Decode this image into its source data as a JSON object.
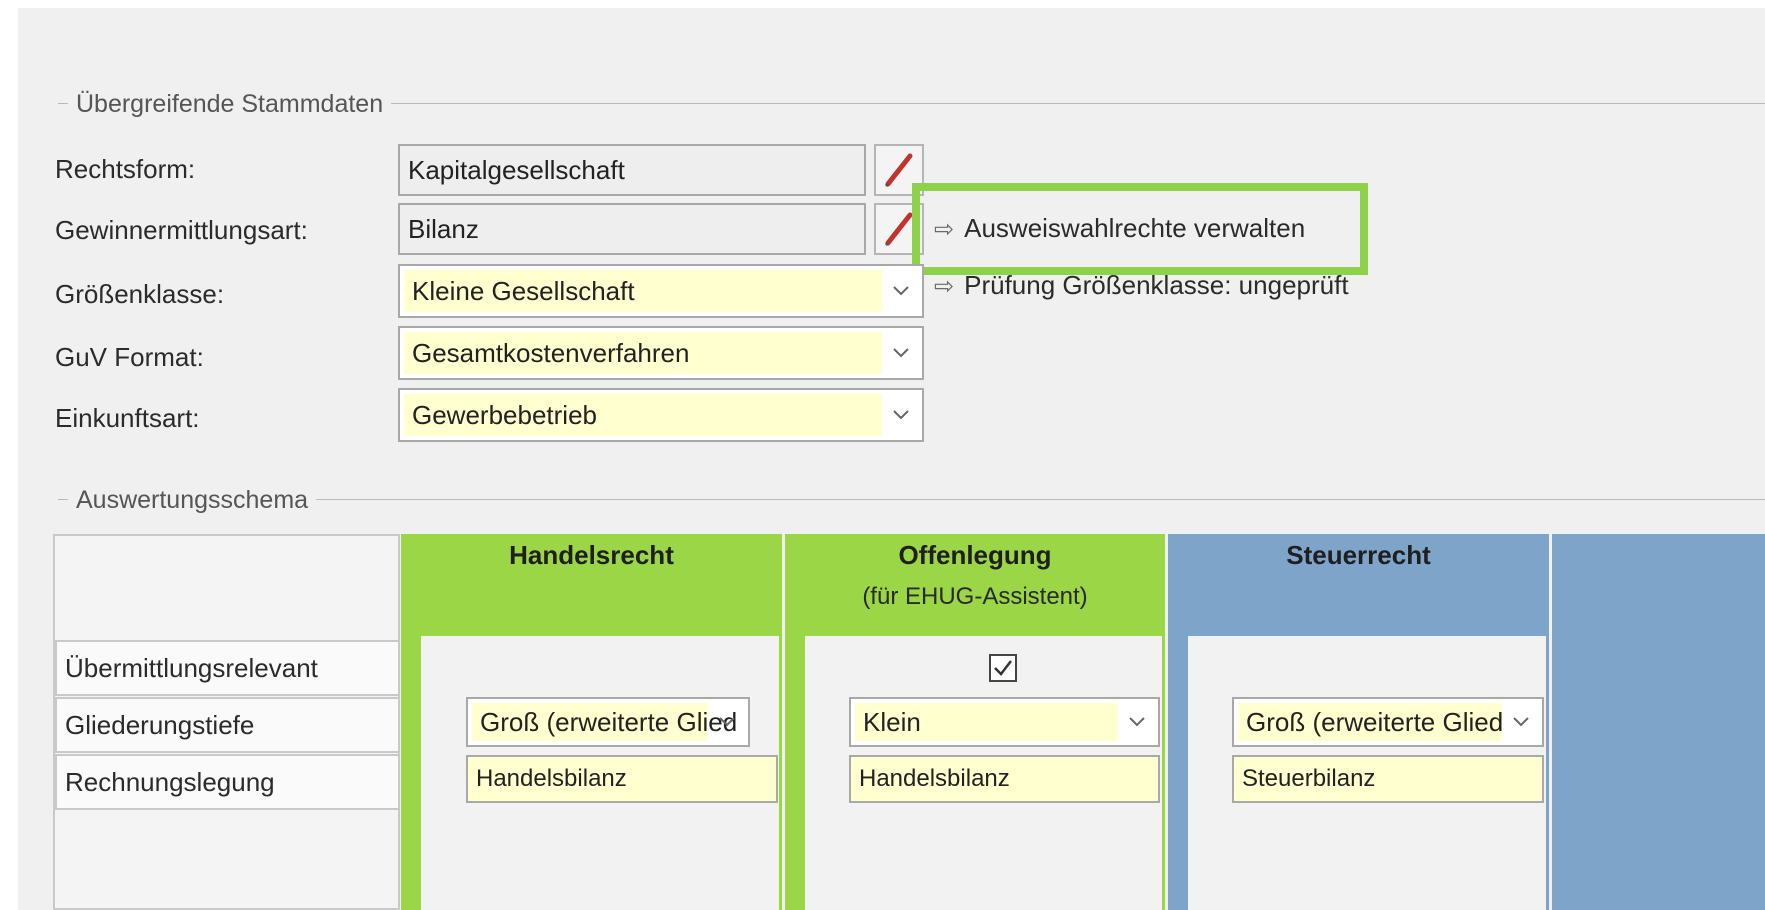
{
  "sections": {
    "stammdaten_title": "Übergreifende Stammdaten",
    "auswertung_title": "Auswertungsschema"
  },
  "fields": {
    "rechtsform": {
      "label": "Rechtsform:",
      "value": "Kapitalgesellschaft"
    },
    "gewinnermittlungsart": {
      "label": "Gewinnermittlungsart:",
      "value": "Bilanz"
    },
    "groessenklasse": {
      "label": "Größenklasse:",
      "value": "Kleine Gesellschaft"
    },
    "guv_format": {
      "label": "GuV Format:",
      "value": "Gesamtkostenverfahren"
    },
    "einkunftsart": {
      "label": "Einkunftsart:",
      "value": "Gewerbebetrieb"
    }
  },
  "links": {
    "ausweiswahlrechte": "Ausweiswahlrechte verwalten",
    "pruefung": "Prüfung Größenklasse: ungeprüft",
    "arrow_glyph": "⇨"
  },
  "table": {
    "columns": {
      "handelsrecht": {
        "title": "Handelsrecht"
      },
      "offenlegung": {
        "title": "Offenlegung",
        "subtitle": "(für EHUG-Assistent)"
      },
      "steuerrecht": {
        "title": "Steuerrecht"
      }
    },
    "rows": {
      "uebermittlungsrelevant": "Übermittlungsrelevant",
      "gliederungstiefe": "Gliederungstiefe",
      "rechnungslegung": "Rechnungslegung"
    },
    "cells": {
      "handelsrecht_gliederung": "Groß (erweiterte Glied",
      "handelsrecht_rechnung": "Handelsbilanz",
      "offenlegung_checked": true,
      "offenlegung_gliederung": "Klein",
      "offenlegung_rechnung": "Handelsbilanz",
      "steuerrecht_gliederung": "Groß (erweiterte Glied",
      "steuerrecht_rechnung": "Steuerbilanz"
    }
  },
  "colors": {
    "green": "#9ad646",
    "blue": "#7ea4c9",
    "highlight": "#8dd24a",
    "input_yellow": "#ffffd0"
  }
}
